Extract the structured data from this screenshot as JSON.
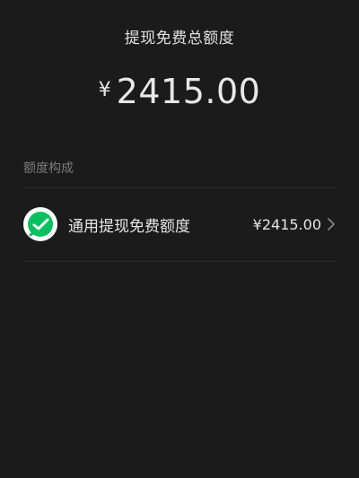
{
  "header": {
    "title": "提现免费总额度"
  },
  "total": {
    "currency_symbol": "¥",
    "amount": "2415.00"
  },
  "section": {
    "title": "额度构成"
  },
  "items": [
    {
      "icon": "wechat-pay-icon",
      "label": "通用提现免费额度",
      "value": "¥2415.00"
    }
  ],
  "colors": {
    "background": "#1b1b1b",
    "text_primary": "#e6e6e6",
    "text_secondary": "#7a7a7a",
    "divider": "#2e2e2e",
    "wechat_green": "#07c160"
  }
}
